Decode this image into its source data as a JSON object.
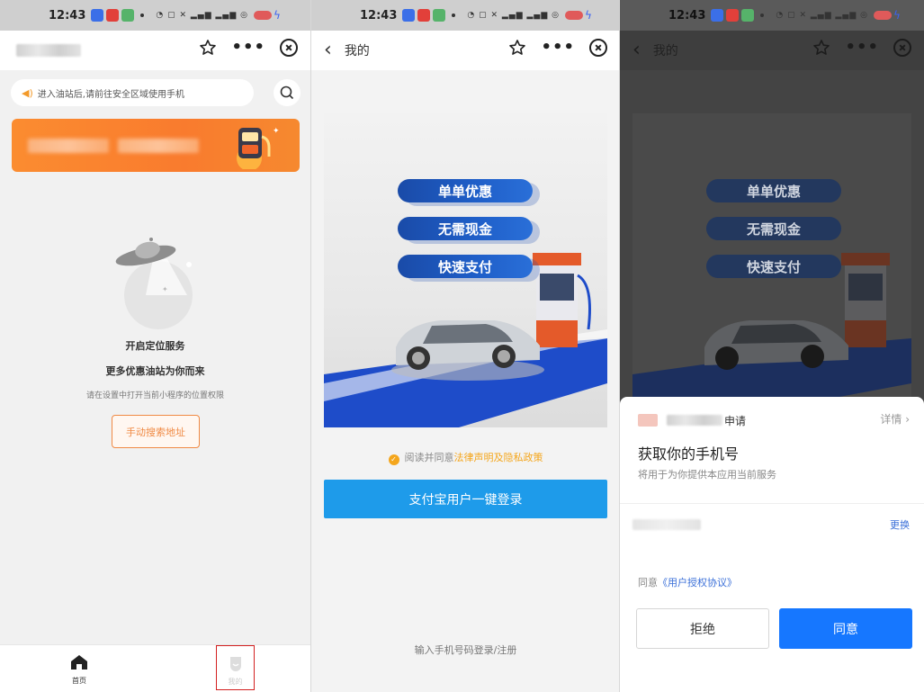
{
  "status_bar": {
    "time": "12:43"
  },
  "screen1": {
    "search_placeholder": "进入油站后,请前往安全区域使用手机",
    "empty": {
      "title": "开启定位服务",
      "subtitle": "更多优惠油站为你而来",
      "hint": "请在设置中打开当前小程序的位置权限",
      "manual_button": "手动搜索地址"
    },
    "tabs": [
      {
        "label": "首页"
      },
      {
        "label": "我的"
      }
    ]
  },
  "screen2": {
    "nav_title": "我的",
    "hero_pills": [
      "单单优惠",
      "无需现金",
      "快速支付"
    ],
    "agree_prefix": "阅读并同意",
    "agree_link": "法律声明及隐私政策",
    "login_button": "支付宝用户一键登录",
    "phone_login": "输入手机号码登录/注册"
  },
  "screen3": {
    "nav_title": "我的",
    "hero_pills": [
      "单单优惠",
      "无需现金",
      "快速支付"
    ],
    "sheet": {
      "applicant_suffix": "申请",
      "detail": "详情",
      "title": "获取你的手机号",
      "subtitle": "将用于为你提供本应用当前服务",
      "change": "更换",
      "agree_prefix": "同意",
      "agree_link": "《用户授权协议》",
      "reject_button": "拒绝",
      "agree_button": "同意"
    }
  },
  "colors": {
    "orange": "#f08a44",
    "alipay_blue": "#1e9bea",
    "primary_blue": "#1677ff",
    "link_blue": "#3a6fd8",
    "accent_yellow": "#f4a61c",
    "pill_blue": "#1a4ba8"
  },
  "icons": [
    "star-icon",
    "more-icon",
    "close-icon",
    "back-icon",
    "search-icon",
    "speaker-icon",
    "ufo-illustration",
    "home-icon",
    "mine-icon",
    "check-icon",
    "chevron-right-icon"
  ]
}
